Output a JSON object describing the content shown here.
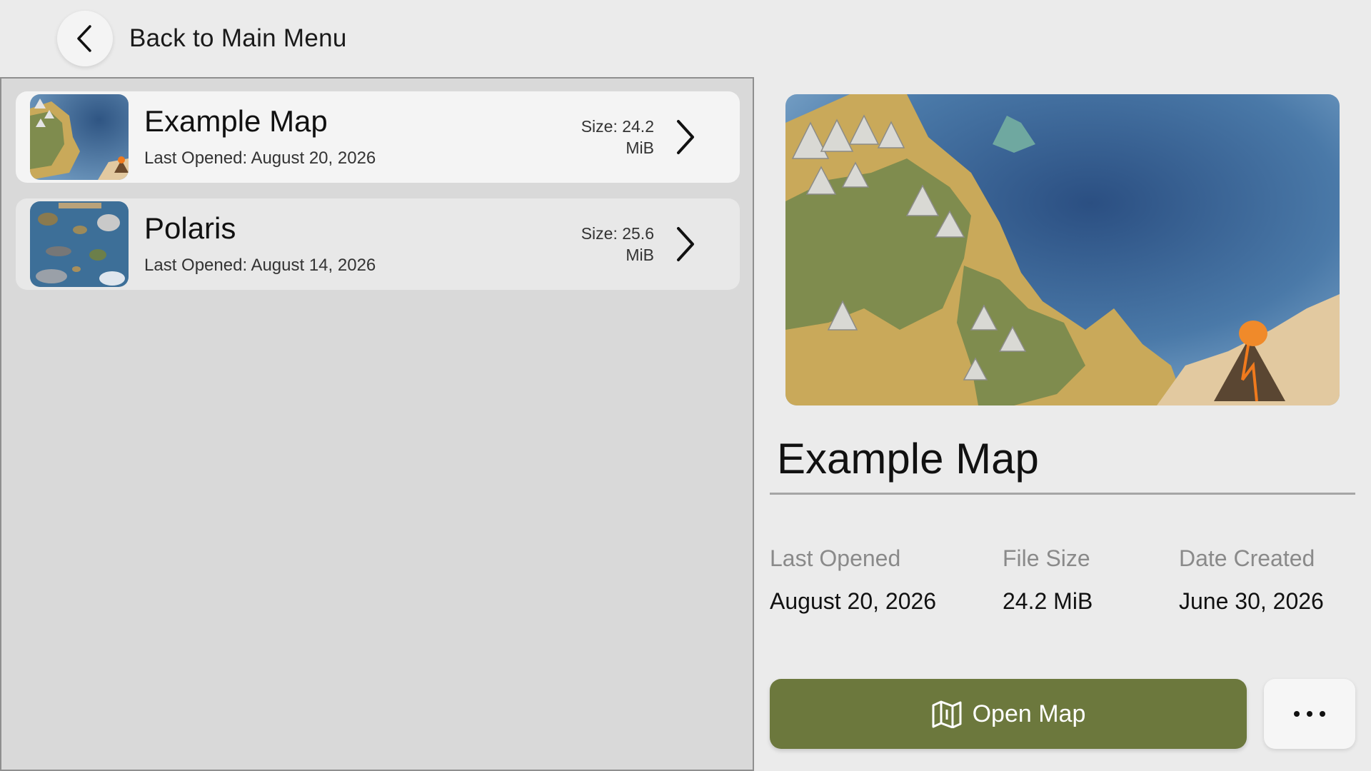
{
  "header": {
    "back_label": "Back to Main Menu",
    "back_icon": "chevron-left-icon"
  },
  "maps": [
    {
      "name": "Example Map",
      "last_opened": "Last Opened: August 20, 2026",
      "size_line1": "Size: 24.2",
      "size_line2": "MiB",
      "selected": true
    },
    {
      "name": "Polaris",
      "last_opened": "Last Opened: August 14, 2026",
      "size_line1": "Size: 25.6",
      "size_line2": "MiB",
      "selected": false
    }
  ],
  "details": {
    "title": "Example Map",
    "labels": {
      "last_opened": "Last Opened",
      "file_size": "File Size",
      "date_created": "Date Created"
    },
    "values": {
      "last_opened": "August 20, 2026",
      "file_size": "24.2 MiB",
      "date_created": "June 30, 2026"
    },
    "open_button": "Open Map",
    "open_icon": "map-icon",
    "more_icon": "more-horizontal-icon"
  },
  "colors": {
    "accent": "#6c783d",
    "ocean": "#3f6b9a",
    "land": "#7f8c4e",
    "sand": "#c9a95a"
  }
}
